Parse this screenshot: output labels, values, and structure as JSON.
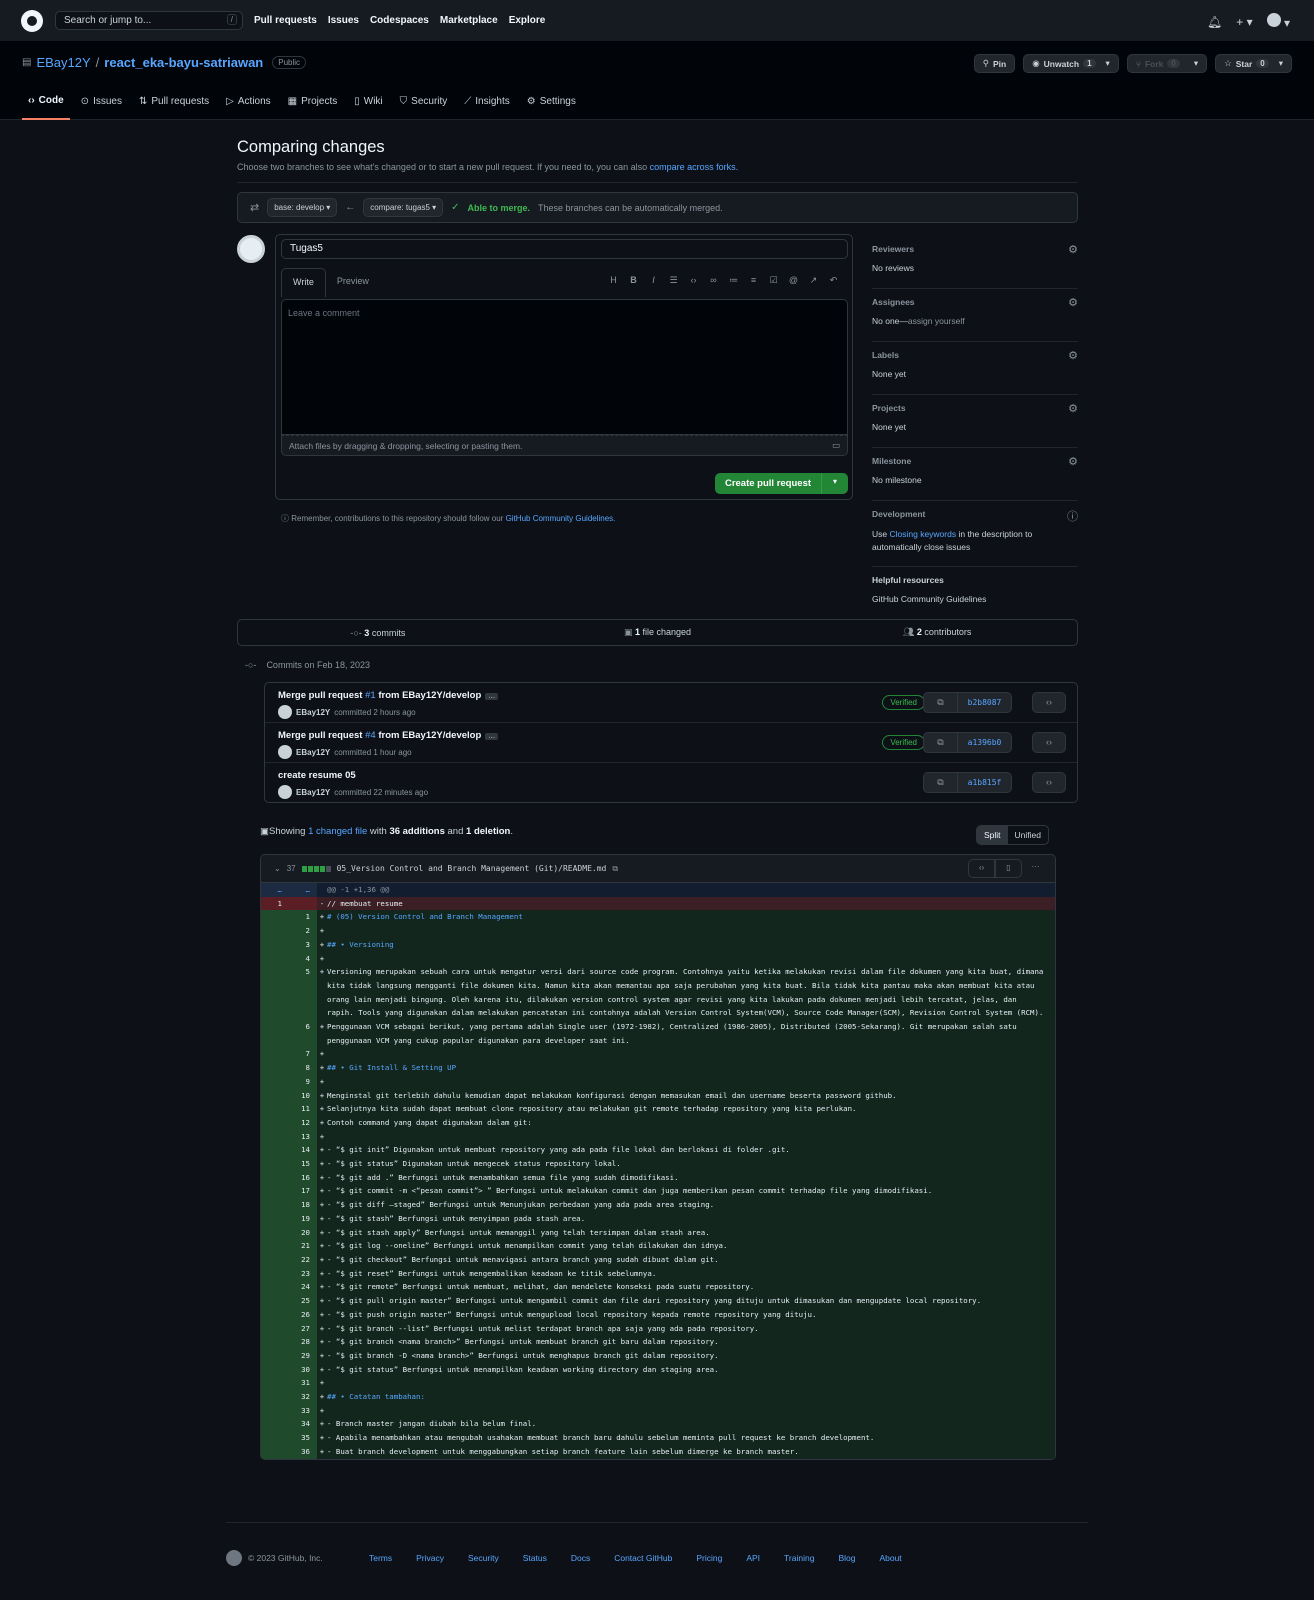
{
  "topbar": {
    "search_placeholder": "Search or jump to...",
    "search_kbd": "/",
    "nav": [
      "Pull requests",
      "Issues",
      "Codespaces",
      "Marketplace",
      "Explore"
    ]
  },
  "repo": {
    "owner": "EBay12Y",
    "separator": "/",
    "name": "react_eka-bayu-satriawan",
    "visibility": "Public",
    "pin_label": "Pin",
    "unwatch_label": "Unwatch",
    "unwatch_count": "1",
    "fork_label": "Fork",
    "fork_count": "0",
    "star_label": "Star",
    "star_count": "0"
  },
  "tabs": [
    "Code",
    "Issues",
    "Pull requests",
    "Actions",
    "Projects",
    "Wiki",
    "Security",
    "Insights",
    "Settings"
  ],
  "compare": {
    "title": "Comparing changes",
    "subtitle": "Choose two branches to see what’s changed or to start a new pull request. If you need to, you can also",
    "subtitle_link": "compare across forks.",
    "base": "base: develop",
    "compare_branch": "compare: tugas5",
    "merge_ok": "Able to merge.",
    "merge_msg": "These branches can be automatically merged."
  },
  "pr": {
    "title_value": "Tugas5",
    "write_tab": "Write",
    "preview_tab": "Preview",
    "comment_placeholder": "Leave a comment",
    "attach_hint": "Attach files by dragging & dropping, selecting or pasting them.",
    "create_label": "Create pull request",
    "remember_text": "Remember, contributions to this repository should follow our",
    "remember_link": "GitHub Community Guidelines."
  },
  "sidebar": {
    "reviewers": {
      "h": "Reviewers",
      "v": "No reviews"
    },
    "assignees": {
      "h": "Assignees",
      "v": "No one—",
      "link": "assign yourself"
    },
    "labels": {
      "h": "Labels",
      "v": "None yet"
    },
    "projects": {
      "h": "Projects",
      "v": "None yet"
    },
    "milestone": {
      "h": "Milestone",
      "v": "No milestone"
    },
    "development": {
      "h": "Development",
      "pre": "Use ",
      "link": "Closing keywords",
      "post": " in the description to automatically close issues"
    },
    "helpful": {
      "h": "Helpful resources",
      "link": "GitHub Community Guidelines"
    }
  },
  "stats": {
    "commits_n": "3",
    "commits_label": "commits",
    "files_n": "1",
    "files_label": "file changed",
    "contributors_n": "2",
    "contributors_label": "contributors"
  },
  "commits_date": "Commits on Feb 18, 2023",
  "commits": [
    {
      "pre": "Merge pull request ",
      "pr": "#1",
      "post": " from EBay12Y/develop",
      "author": "EBay12Y",
      "when": "committed 2 hours ago",
      "verified": "Verified",
      "sha": "b2b8087"
    },
    {
      "pre": "Merge pull request ",
      "pr": "#4",
      "post": " from EBay12Y/develop",
      "author": "EBay12Y",
      "when": "committed 1 hour ago",
      "verified": "Verified",
      "sha": "a1396b0"
    },
    {
      "pre": "create resume 05",
      "pr": "",
      "post": "",
      "author": "EBay12Y",
      "when": "committed 22 minutes ago",
      "verified": "",
      "sha": "a1b815f"
    }
  ],
  "showing": {
    "pre": "Showing ",
    "link": "1 changed file",
    "mid": " with ",
    "adds": "36 additions",
    "and": " and ",
    "dels": "1 deletion",
    "end": "."
  },
  "view_toggle": {
    "split": "Split",
    "unified": "Unified"
  },
  "diff": {
    "count": "37",
    "path": "05_Version Control and Branch Management (Git)/README.md",
    "hunk": "@@ -1 +1,36 @@",
    "del_line": "// membuat resume",
    "lines": [
      {
        "t": "# (05) Version Control and Branch Management",
        "h": true
      },
      {
        "t": ""
      },
      {
        "t": "## • Versioning",
        "h": true
      },
      {
        "t": ""
      },
      {
        "t": "Versioning merupakan sebuah cara untuk mengatur versi dari source code program. Contohnya yaitu ketika melakukan revisi dalam file dokumen yang kita buat, dimana kita tidak langsung mengganti file dokumen kita. Namun kita akan memantau apa saja perubahan yang kita buat. Bila tidak kita pantau maka akan membuat kita atau orang lain menjadi bingung. Oleh karena itu, dilakukan version control system agar revisi yang kita lakukan pada dokumen menjadi lebih tercatat, jelas, dan rapih. Tools yang digunakan dalam melakukan pencatatan ini contohnya adalah Version Control System(VCM), Source Code Manager(SCM), Revision Control System (RCM)."
      },
      {
        "t": "Penggunaan VCM sebagai berikut, yang pertama adalah Single user (1972-1982), Centralized (1986-2005), Distributed (2005-Sekarang). Git merupakan salah satu penggunaan VCM yang cukup popular digunakan para developer saat ini."
      },
      {
        "t": ""
      },
      {
        "t": "## • Git Install & Setting UP",
        "h": true
      },
      {
        "t": ""
      },
      {
        "t": "Menginstal git terlebih dahulu kemudian dapat melakukan konfigurasi dengan memasukan email dan username beserta password github."
      },
      {
        "t": "Selanjutnya kita sudah dapat membuat clone repository atau melakukan git remote terhadap repository yang kita perlukan."
      },
      {
        "t": "Contoh command yang dapat digunakan dalam git:"
      },
      {
        "t": ""
      },
      {
        "t": "- “$ git init” Digunakan untuk membuat repository yang ada pada file lokal dan berlokasi di folder .git."
      },
      {
        "t": "- “$ git status” Digunakan untuk mengecek status repository lokal."
      },
      {
        "t": "- “$ git add .” Berfungsi untuk menambahkan semua file yang sudah dimodifikasi."
      },
      {
        "t": "- “$ git commit -m <“pesan commit”> ” Berfungsi untuk melakukan commit dan juga memberikan pesan commit terhadap file yang dimodifikasi."
      },
      {
        "t": "- “$ git diff –staged” Berfungsi untuk Menunjukan perbedaan yang ada pada area staging."
      },
      {
        "t": "- “$ git stash” Berfungsi untuk menyimpan pada stash area."
      },
      {
        "t": "- “$ git stash apply” Berfungsi untuk memanggil yang telah tersimpan dalam stash area."
      },
      {
        "t": "- “$ git log --oneline” Berfungsi untuk menampilkan commit yang telah dilakukan dan idnya."
      },
      {
        "t": "- “$ git checkout” Berfungsi untuk menavigasi antara branch yang sudah dibuat dalam git."
      },
      {
        "t": "- “$ git reset” Berfungsi untuk mengembalikan keadaan ke titik sebelumnya."
      },
      {
        "t": "- “$ git remote” Berfungsi untuk membuat, melihat, dan mendelete konseksi pada suatu repository."
      },
      {
        "t": "- “$ git pull origin master” Berfungsi untuk mengambil commit dan file dari repository yang dituju untuk dimasukan dan mengupdate local repository."
      },
      {
        "t": "- “$ git push origin master” Berfungsi untuk mengupload local repository kepada remote repository yang dituju."
      },
      {
        "t": "- “$ git branch --list” Berfungsi untuk melist terdapat branch apa saja yang ada pada repository."
      },
      {
        "t": "- “$ git branch <nama branch>” Berfungsi untuk membuat branch git baru dalam repository."
      },
      {
        "t": "- “$ git branch -D <nama branch>” Berfungsi untuk menghapus branch git dalam repository."
      },
      {
        "t": "- “$ git status” Berfungsi untuk menampilkan keadaan working directory dan staging area."
      },
      {
        "t": ""
      },
      {
        "t": "## • Catatan tambahan:",
        "h": true
      },
      {
        "t": ""
      },
      {
        "t": "- Branch master jangan diubah bila belum final."
      },
      {
        "t": "- Apabila menambahkan atau mengubah usahakan membuat branch baru dahulu sebelum meminta pull request ke branch development."
      },
      {
        "t": "- Buat branch development untuk menggabungkan setiap branch feature lain sebelum dimerge ke branch master."
      }
    ]
  },
  "footer": {
    "copyright": "© 2023 GitHub, Inc.",
    "links": [
      "Terms",
      "Privacy",
      "Security",
      "Status",
      "Docs",
      "Contact GitHub",
      "Pricing",
      "API",
      "Training",
      "Blog",
      "About"
    ]
  }
}
